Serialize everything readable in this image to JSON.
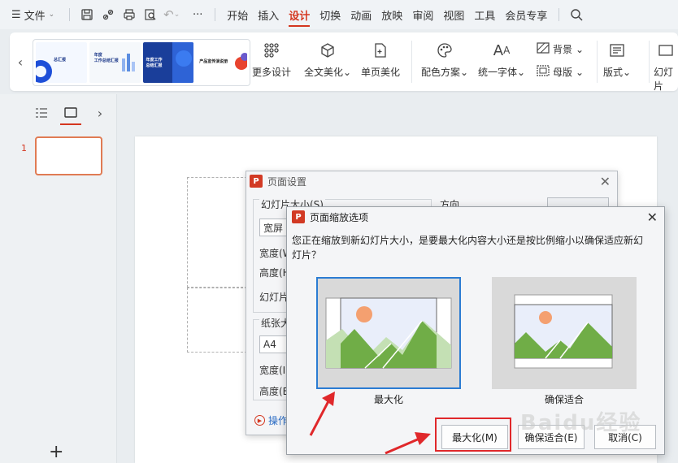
{
  "menubar": {
    "file_label": "文件",
    "tabs": [
      {
        "label": "开始"
      },
      {
        "label": "插入"
      },
      {
        "label": "设计",
        "active": true
      },
      {
        "label": "切换"
      },
      {
        "label": "动画"
      },
      {
        "label": "放映"
      },
      {
        "label": "审阅"
      },
      {
        "label": "视图"
      },
      {
        "label": "工具"
      },
      {
        "label": "会员专享"
      }
    ],
    "icons": [
      "save-icon",
      "share-icon",
      "print-icon",
      "preview-icon",
      "undo-icon",
      "more-icon",
      "search-icon"
    ],
    "more_label": "···"
  },
  "ribbon": {
    "thumbs": [
      {
        "text": "总汇报"
      },
      {
        "text": "年度\n工作总结汇报"
      },
      {
        "text": "年度工作\n总结汇报"
      },
      {
        "text": "产品宣传演说册"
      }
    ],
    "more_design": "更多设计",
    "full_beautify": "全文美化",
    "single_beautify": "单页美化",
    "color_scheme": "配色方案",
    "unify_font": "统一字体",
    "background": "背景",
    "master": "母版",
    "layout": "版式",
    "slide_cut": "幻灯片"
  },
  "leftpanel": {
    "slide_number": "1",
    "add_label": "+"
  },
  "page_setup": {
    "title": "页面设置",
    "slide_size_label": "幻灯片大小(S)",
    "slide_size_value": "宽屏",
    "width_label": "宽度(W",
    "height_label": "高度(H",
    "slide_label": "幻灯片",
    "direction_label": "方向",
    "paper_label": "纸张大",
    "paper_value": "A4",
    "paper_width_label": "宽度(I",
    "paper_height_label": "高度(E",
    "tip_label": "操作"
  },
  "scale_dialog": {
    "title": "页面缩放选项",
    "message": "您正在缩放到新幻灯片大小，是要最大化内容大小还是按比例缩小以确保适应新幻灯片？",
    "option_maximize": "最大化",
    "option_fit": "确保适合",
    "btn_maximize": "最大化(M)",
    "btn_fit": "确保适合(E)",
    "btn_cancel": "取消(C)"
  },
  "colors": {
    "accent": "#d4361f",
    "selection": "#2b7cd3",
    "annotation": "#e0282b",
    "mountain": "#70ad47",
    "sun": "#f4a070"
  },
  "watermark": "Baidu经验"
}
